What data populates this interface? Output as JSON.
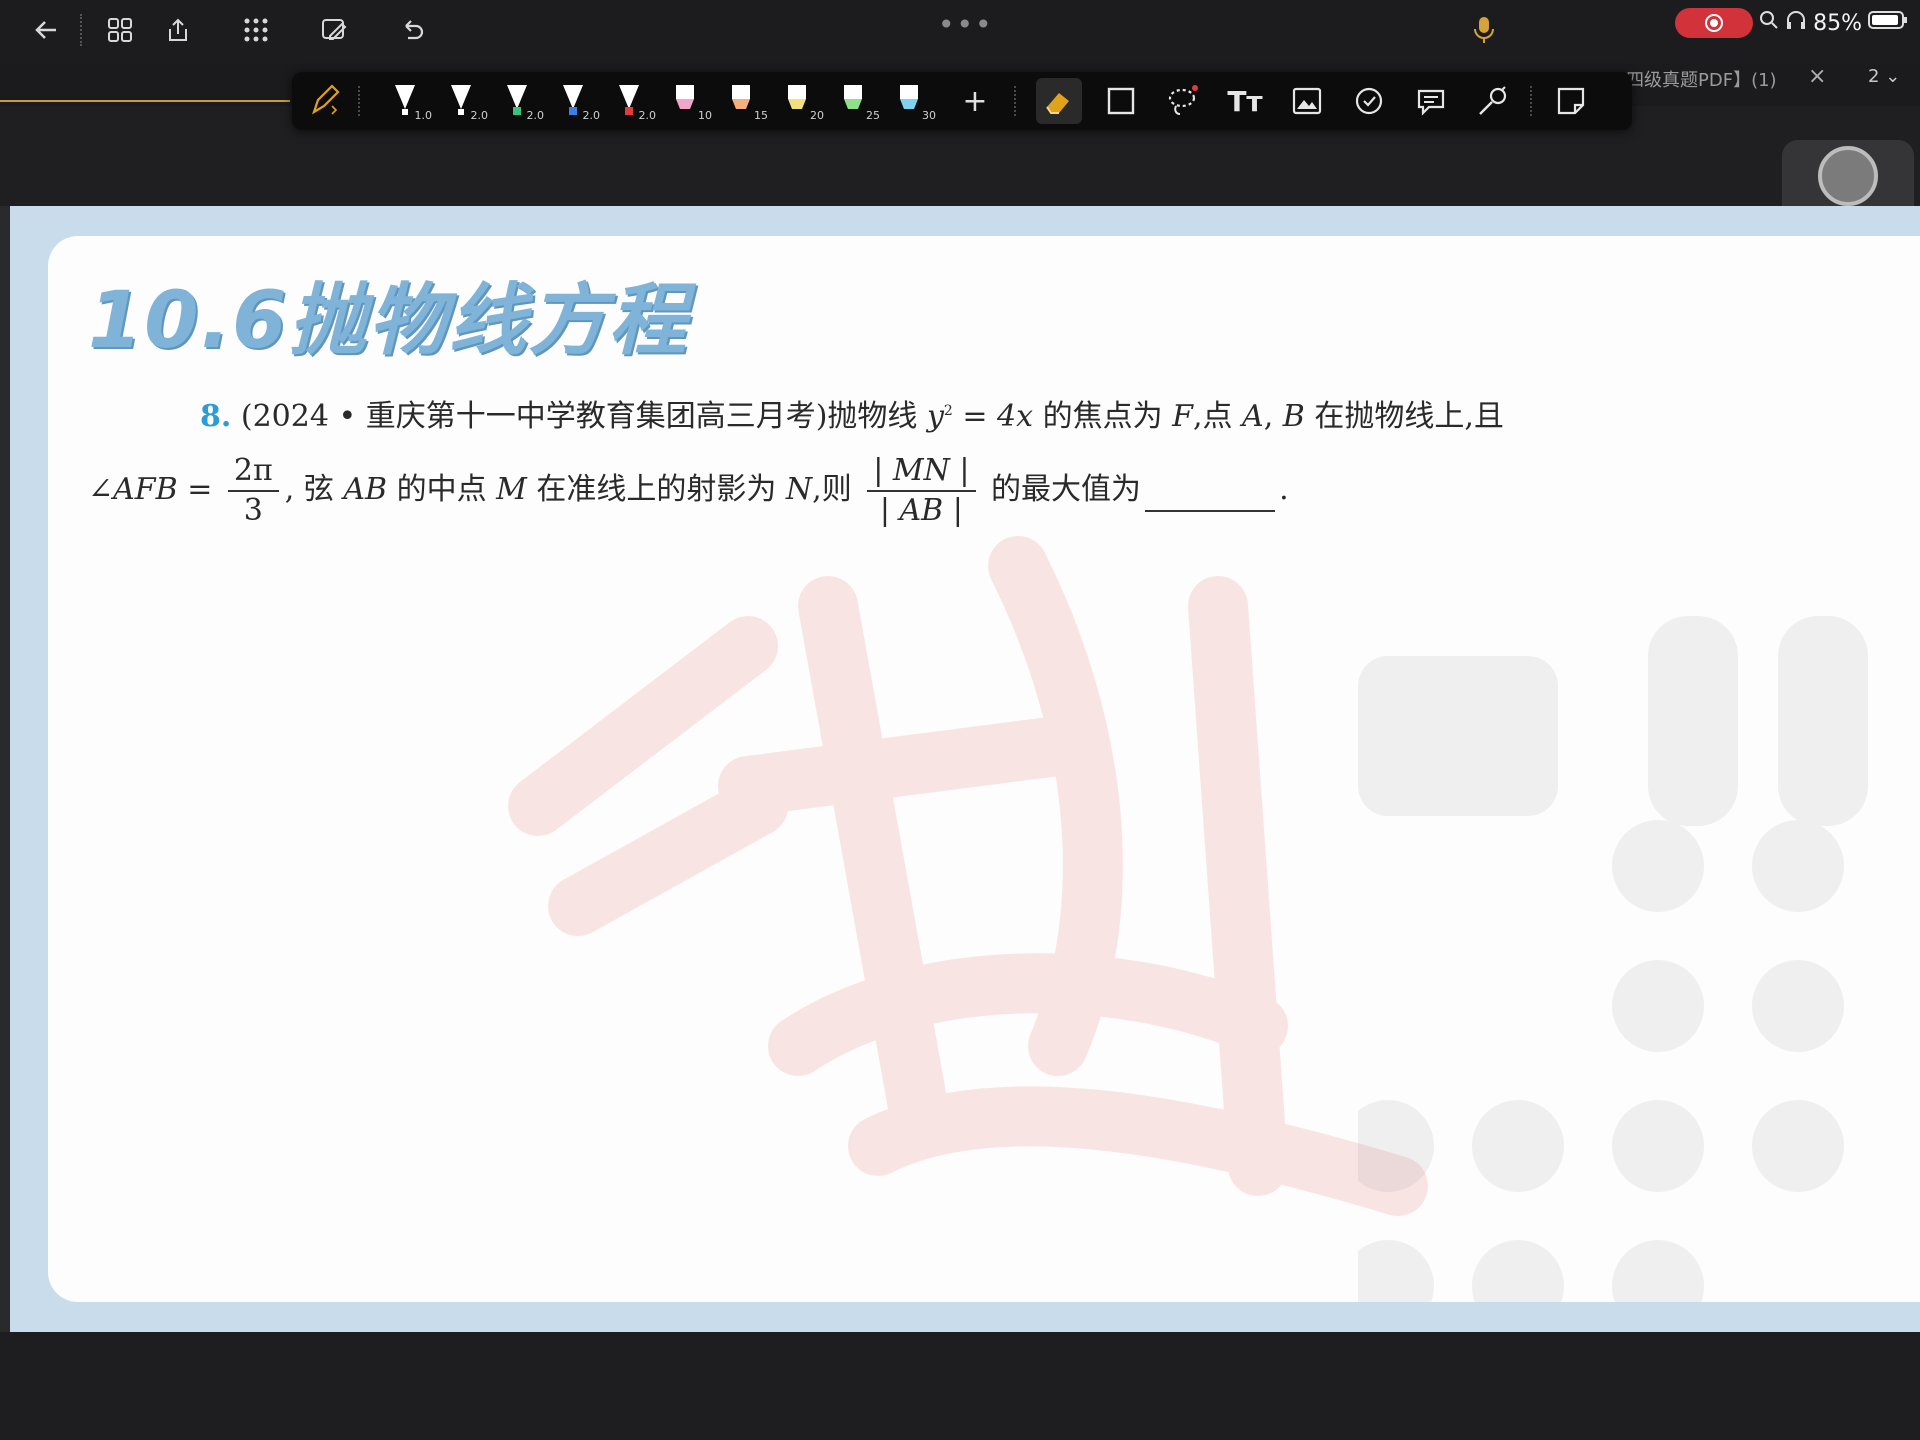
{
  "topbar": {
    "icons": [
      "back-icon",
      "grid-icon",
      "export-icon",
      "apps-icon",
      "edit-doc-icon",
      "undo-icon"
    ],
    "more_dots": "•••",
    "mic_color": "#d6a23a",
    "status": {
      "battery": "85%",
      "rec_color": "#d2323a"
    }
  },
  "tabs": {
    "title": "四级真题PDF】(1)",
    "close": "×",
    "page_selector": "2"
  },
  "pen_toolbar": {
    "pens": [
      {
        "size": "1.0",
        "color": "#ffffff"
      },
      {
        "size": "2.0",
        "color": "#ffffff"
      },
      {
        "size": "2.0",
        "color": "#39c27a"
      },
      {
        "size": "2.0",
        "color": "#3a7ee8"
      },
      {
        "size": "2.0",
        "color": "#e23b3b"
      },
      {
        "size": "10",
        "color": "#f3a6c8"
      },
      {
        "size": "15",
        "color": "#f4b07a"
      },
      {
        "size": "20",
        "color": "#f2e27a"
      },
      {
        "size": "25",
        "color": "#8ee08a"
      },
      {
        "size": "30",
        "color": "#7fd3f0"
      }
    ],
    "add": "+",
    "tools": [
      "eraser-icon",
      "rectangle-icon",
      "lasso-icon",
      "text-tool-icon",
      "image-icon",
      "sticker-icon",
      "comment-icon",
      "laser-pointer-icon",
      "crop-icon"
    ],
    "text_tool": "Tт",
    "accent_color": "#e0a11b"
  },
  "document": {
    "heading": "10.6抛物线方程",
    "heading_color": "#7fb3d8",
    "problem": {
      "number": "8.",
      "source": "(2024 • 重庆第十一中学教育集团高三月考)抛物线",
      "eq_y": "y",
      "eq_exp": "2",
      "eq_rest": " = 4x",
      "text1": " 的焦点为",
      "F": "F",
      "text2": ",点 ",
      "A": "A",
      "comma": ", ",
      "B": "B",
      "text3": " 在抛物线上,且",
      "angle": "∠AFB =",
      "frac1_num": "2π",
      "frac1_den": "3",
      "text4": ", 弦 ",
      "AB": "AB",
      "text5": " 的中点 ",
      "M": "M",
      "text6": " 在准线上的射影为 ",
      "N": "N",
      "text7": ",则",
      "frac2_num": "| MN |",
      "frac2_den": "| AB |",
      "text8": " 的最大值为",
      "period": "."
    },
    "watermark_color": "#e23b3b"
  }
}
